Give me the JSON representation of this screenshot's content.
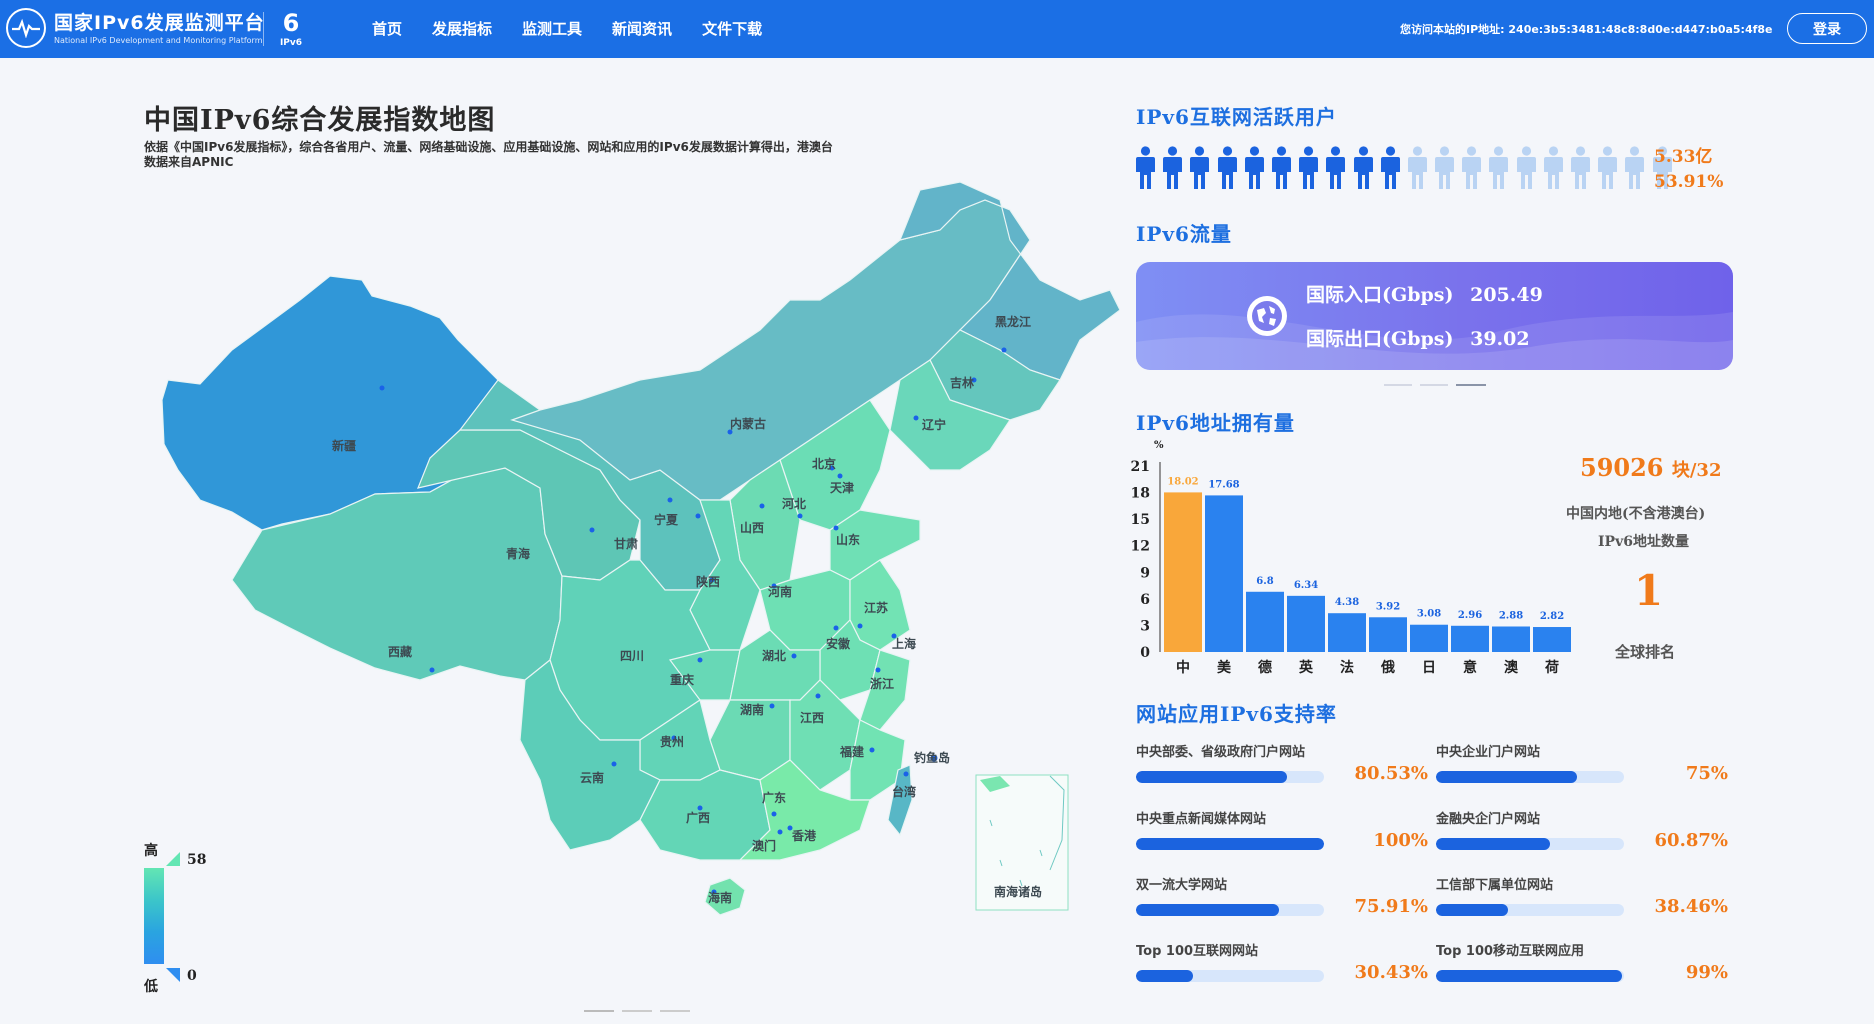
{
  "header": {
    "logo_title": "国家IPv6发展监测平台",
    "logo_subtitle": "National IPv6 Development and Monitoring Platform",
    "ipv6_badge": "IPv6",
    "nav": [
      "首页",
      "发展指标",
      "监测工具",
      "新闻资讯",
      "文件下载"
    ],
    "ip_notice": "您访问本站的IP地址: 240e:3b5:3481:48c8:8d0e:d447:b0a5:4f8e",
    "login_label": "登录"
  },
  "map": {
    "title": "中国IPv6综合发展指数地图",
    "description": "依据《中国IPv6发展指标》，综合各省用户、流量、网络基础设施、应用基础设施、网站和应用的IPv6发展数据计算得出，港澳台数据来自APNIC",
    "provinces": [
      "黑龙江",
      "吉林",
      "辽宁",
      "内蒙古",
      "北京",
      "天津",
      "河北",
      "宁夏",
      "山西",
      "山东",
      "甘肃",
      "青海",
      "新疆",
      "陕西",
      "河南",
      "江苏",
      "安徽",
      "上海",
      "西藏",
      "四川",
      "湖北",
      "重庆",
      "浙江",
      "湖南",
      "江西",
      "贵州",
      "福建",
      "钓鱼岛",
      "云南",
      "台湾",
      "广东",
      "广西",
      "香港",
      "澳门",
      "海南",
      "南海诸岛"
    ],
    "legend": {
      "high_label": "高",
      "low_label": "低",
      "max": "58",
      "min": "0"
    }
  },
  "users": {
    "title": "IPv6互联网活跃用户",
    "count": "5.33亿",
    "percent": "53.91%",
    "ratio": 0.5391
  },
  "traffic": {
    "title": "IPv6流量",
    "inbound_label": "国际入口(Gbps)",
    "inbound_value": "205.49",
    "outbound_label": "国际出口(Gbps)",
    "outbound_value": "39.02"
  },
  "address": {
    "title": "IPv6地址拥有量",
    "count": "59026",
    "count_unit": "块/32",
    "desc_line1": "中国内地(不含港澳台)",
    "desc_line2": "IPv6地址数量",
    "rank": "1",
    "rank_label": "全球排名"
  },
  "chart_data": {
    "type": "bar",
    "categories": [
      "中",
      "美",
      "德",
      "英",
      "法",
      "俄",
      "日",
      "意",
      "澳",
      "荷"
    ],
    "values": [
      18.02,
      17.68,
      6.8,
      6.34,
      4.38,
      3.92,
      3.08,
      2.96,
      2.88,
      2.82
    ],
    "ylabel": "%",
    "yticks": [
      0,
      3,
      6,
      9,
      12,
      15,
      18,
      21
    ],
    "ylim": [
      0,
      21
    ],
    "highlight_color": "#f9a73a",
    "bar_color": "#2a82ef"
  },
  "sites": {
    "title": "网站应用IPv6支持率",
    "items": [
      {
        "label": "中央部委、省级政府门户网站",
        "percent": "80.53%",
        "value": 0.8053
      },
      {
        "label": "中央企业门户网站",
        "percent": "75%",
        "value": 0.75
      },
      {
        "label": "中央重点新闻媒体网站",
        "percent": "100%",
        "value": 1.0
      },
      {
        "label": "金融央企门户网站",
        "percent": "60.87%",
        "value": 0.6087
      },
      {
        "label": "双一流大学网站",
        "percent": "75.91%",
        "value": 0.7591
      },
      {
        "label": "工信部下属单位网站",
        "percent": "38.46%",
        "value": 0.3846
      },
      {
        "label": "Top 100互联网网站",
        "percent": "30.43%",
        "value": 0.3043
      },
      {
        "label": "Top 100移动互联网应用",
        "percent": "99%",
        "value": 0.99
      }
    ]
  }
}
